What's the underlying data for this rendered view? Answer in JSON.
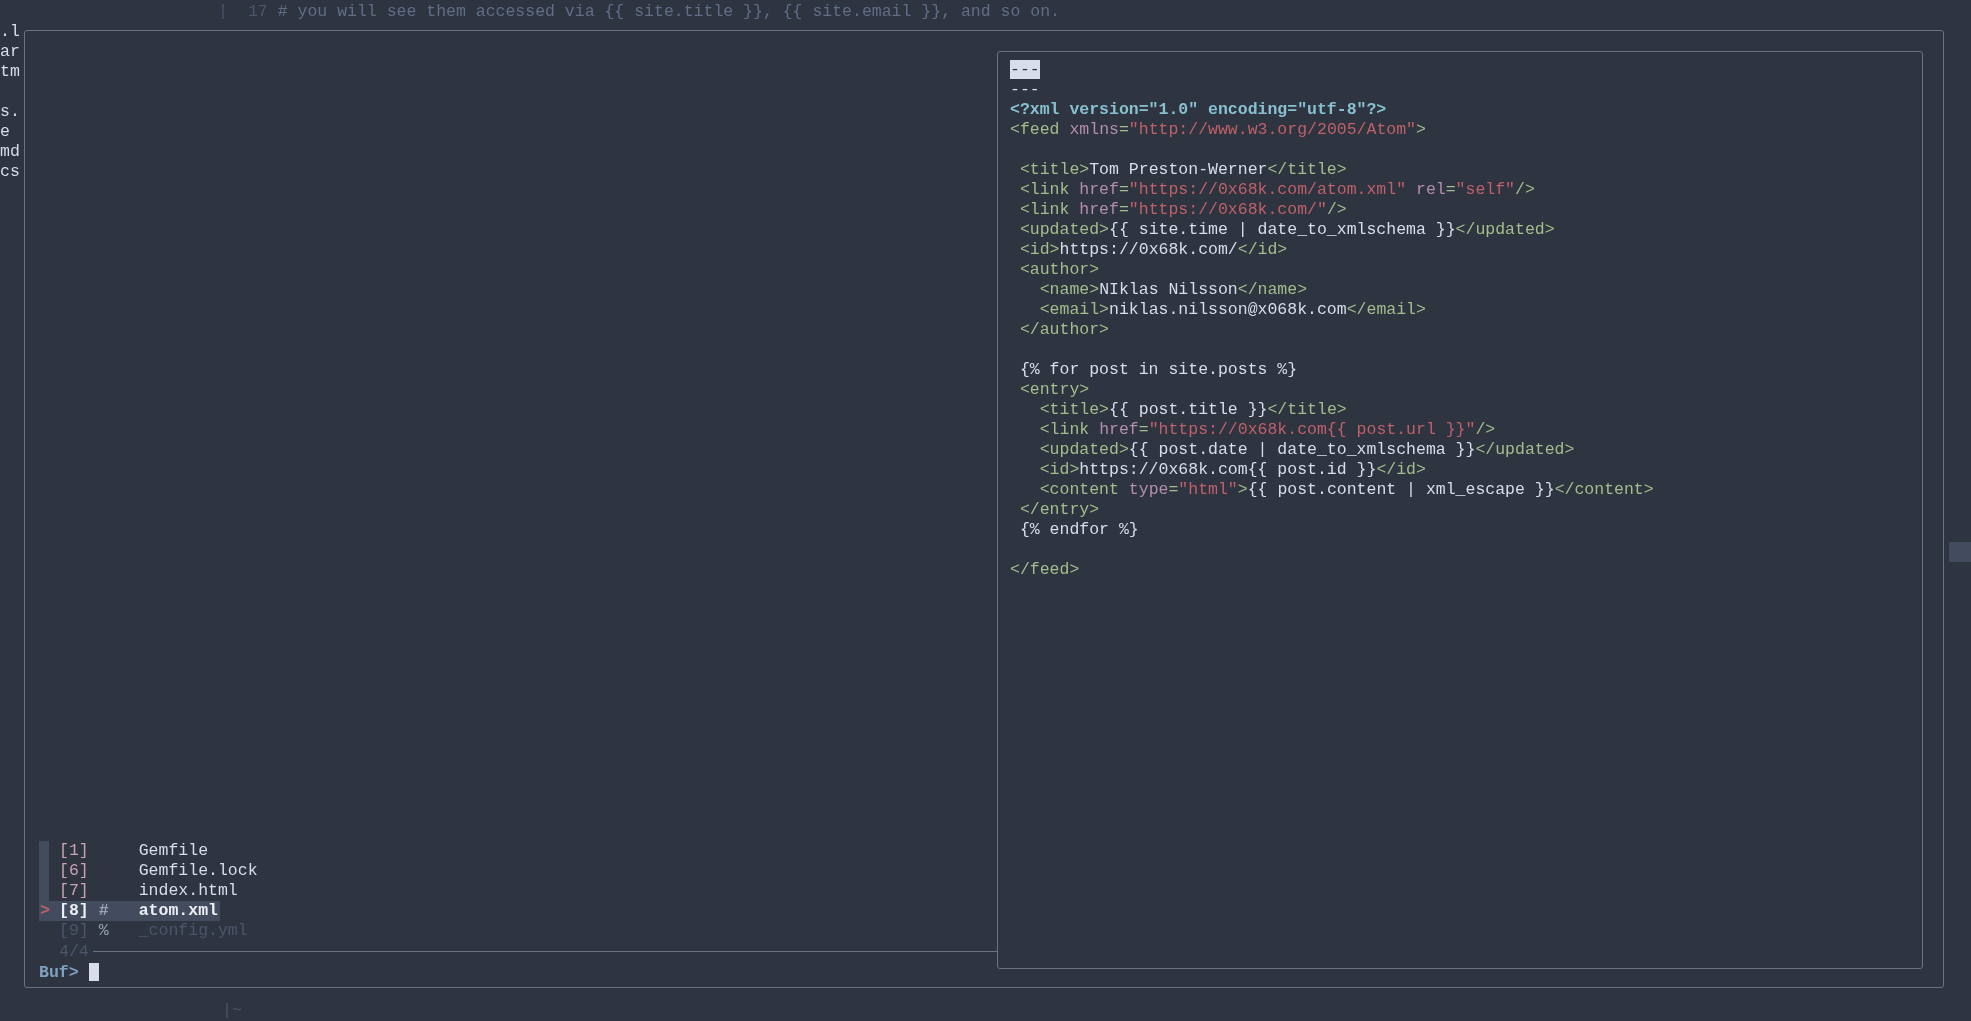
{
  "background_editor": {
    "top_line": {
      "separator": "|",
      "line_number": "17",
      "comment": "# you will see them accessed via {{ site.title }}, {{ site.email }}, and so on."
    },
    "left_column": [
      {
        "kind": "text",
        "text": ".l"
      },
      {
        "kind": "text",
        "text": "ar"
      },
      {
        "kind": "text",
        "text": "tm"
      },
      {
        "kind": "blank"
      },
      {
        "kind": "text",
        "text": "s."
      },
      {
        "kind": "text",
        "text": "e"
      },
      {
        "kind": "text",
        "text": "md"
      },
      {
        "kind": "text",
        "text": "cs"
      }
    ],
    "bottom_line": "|~"
  },
  "buffer_list": {
    "items": [
      {
        "number": "[1]",
        "name": "Gemfile",
        "selected": false,
        "marked": true,
        "dimmed": false
      },
      {
        "number": "[6]",
        "name": "Gemfile.lock",
        "selected": false,
        "marked": true,
        "dimmed": false
      },
      {
        "number": "[7]",
        "name": "index.html",
        "selected": false,
        "marked": true,
        "dimmed": false
      },
      {
        "number": "[8]",
        "flag": "#",
        "name": "atom.xml",
        "selected": true,
        "marked": true,
        "dimmed": false
      },
      {
        "number": "[9]",
        "flag": "%",
        "name": "_config.yml",
        "selected": false,
        "marked": false,
        "dimmed": true
      }
    ],
    "pointer": ">",
    "counter": "4/4",
    "prompt": "Buf>"
  },
  "preview": {
    "lines": [
      {
        "tokens": [
          {
            "kind": "cursor",
            "text": "---"
          }
        ]
      },
      {
        "tokens": [
          {
            "kind": "text",
            "text": "---"
          }
        ]
      },
      {
        "tokens": [
          {
            "kind": "pi",
            "text": "<?xml version=\"1.0\" encoding=\"utf-8\"?>"
          }
        ]
      },
      {
        "tokens": [
          {
            "kind": "tag",
            "text": "<feed "
          },
          {
            "kind": "attr",
            "text": "xmlns"
          },
          {
            "kind": "tag",
            "text": "="
          },
          {
            "kind": "str",
            "text": "\"http://www.w3.org/2005/Atom\""
          },
          {
            "kind": "tag",
            "text": ">"
          }
        ]
      },
      {
        "tokens": [
          {
            "kind": "blank"
          }
        ]
      },
      {
        "tokens": [
          {
            "kind": "tag",
            "text": " <title>"
          },
          {
            "kind": "text",
            "text": "Tom Preston-Werner"
          },
          {
            "kind": "tag",
            "text": "</title>"
          }
        ]
      },
      {
        "tokens": [
          {
            "kind": "tag",
            "text": " <link "
          },
          {
            "kind": "attr",
            "text": "href"
          },
          {
            "kind": "tag",
            "text": "="
          },
          {
            "kind": "str",
            "text": "\"https://0x68k.com/atom.xml\""
          },
          {
            "kind": "attr",
            "text": " rel"
          },
          {
            "kind": "tag",
            "text": "="
          },
          {
            "kind": "str",
            "text": "\"self\""
          },
          {
            "kind": "tag",
            "text": "/>"
          }
        ]
      },
      {
        "tokens": [
          {
            "kind": "tag",
            "text": " <link "
          },
          {
            "kind": "attr",
            "text": "href"
          },
          {
            "kind": "tag",
            "text": "="
          },
          {
            "kind": "str",
            "text": "\"https://0x68k.com/\""
          },
          {
            "kind": "tag",
            "text": "/>"
          }
        ]
      },
      {
        "tokens": [
          {
            "kind": "tag",
            "text": " <updated>"
          },
          {
            "kind": "text",
            "text": "{{ site.time | date_to_xmlschema }}"
          },
          {
            "kind": "tag",
            "text": "</updated>"
          }
        ]
      },
      {
        "tokens": [
          {
            "kind": "tag",
            "text": " <id>"
          },
          {
            "kind": "text",
            "text": "https://0x68k.com/"
          },
          {
            "kind": "tag",
            "text": "</id>"
          }
        ]
      },
      {
        "tokens": [
          {
            "kind": "tag",
            "text": " <author>"
          }
        ]
      },
      {
        "tokens": [
          {
            "kind": "tag",
            "text": "   <name>"
          },
          {
            "kind": "text",
            "text": "NIklas Nilsson"
          },
          {
            "kind": "tag",
            "text": "</name>"
          }
        ]
      },
      {
        "tokens": [
          {
            "kind": "tag",
            "text": "   <email>"
          },
          {
            "kind": "text",
            "text": "niklas.nilsson@x068k.com"
          },
          {
            "kind": "tag",
            "text": "</email>"
          }
        ]
      },
      {
        "tokens": [
          {
            "kind": "tag",
            "text": " </author>"
          }
        ]
      },
      {
        "tokens": [
          {
            "kind": "blank"
          }
        ]
      },
      {
        "tokens": [
          {
            "kind": "text",
            "text": " {% for post in site.posts %}"
          }
        ]
      },
      {
        "tokens": [
          {
            "kind": "tag",
            "text": " <entry>"
          }
        ]
      },
      {
        "tokens": [
          {
            "kind": "tag",
            "text": "   <title>"
          },
          {
            "kind": "text",
            "text": "{{ post.title }}"
          },
          {
            "kind": "tag",
            "text": "</title>"
          }
        ]
      },
      {
        "tokens": [
          {
            "kind": "tag",
            "text": "   <link "
          },
          {
            "kind": "attr",
            "text": "href"
          },
          {
            "kind": "tag",
            "text": "="
          },
          {
            "kind": "str",
            "text": "\"https://0x68k.com{{ post.url }}\""
          },
          {
            "kind": "tag",
            "text": "/>"
          }
        ]
      },
      {
        "tokens": [
          {
            "kind": "tag",
            "text": "   <updated>"
          },
          {
            "kind": "text",
            "text": "{{ post.date | date_to_xmlschema }}"
          },
          {
            "kind": "tag",
            "text": "</updated>"
          }
        ]
      },
      {
        "tokens": [
          {
            "kind": "tag",
            "text": "   <id>"
          },
          {
            "kind": "text",
            "text": "https://0x68k.com{{ post.id }}"
          },
          {
            "kind": "tag",
            "text": "</id>"
          }
        ]
      },
      {
        "tokens": [
          {
            "kind": "tag",
            "text": "   <content "
          },
          {
            "kind": "attr",
            "text": "type"
          },
          {
            "kind": "tag",
            "text": "="
          },
          {
            "kind": "str",
            "text": "\"html\""
          },
          {
            "kind": "tag",
            "text": ">"
          },
          {
            "kind": "text",
            "text": "{{ post.content | xml_escape }}"
          },
          {
            "kind": "tag",
            "text": "</content>"
          }
        ]
      },
      {
        "tokens": [
          {
            "kind": "tag",
            "text": " </entry>"
          }
        ]
      },
      {
        "tokens": [
          {
            "kind": "text",
            "text": " {% endfor %}"
          }
        ]
      },
      {
        "tokens": [
          {
            "kind": "blank"
          }
        ]
      },
      {
        "tokens": [
          {
            "kind": "tag",
            "text": "</feed>"
          }
        ]
      }
    ]
  }
}
